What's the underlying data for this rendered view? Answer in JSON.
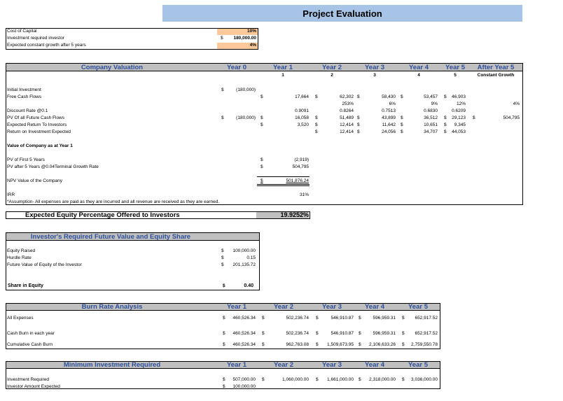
{
  "title": "Project Evaluation",
  "inputs": {
    "rows": [
      {
        "label": "Cost of Capital",
        "cur": "",
        "value": "10%"
      },
      {
        "label": "Investment required investor",
        "cur": "$",
        "value": "180,000.00"
      },
      {
        "label": "Expected constant growth after 5 years",
        "cur": "",
        "value": "4%"
      }
    ]
  },
  "valuation": {
    "title": "Company Valuation",
    "headers": [
      "Year 0",
      "Year 1",
      "Year 2",
      "Year 3",
      "Year 4",
      "Year 5",
      "After Year 5"
    ],
    "numbers": [
      "",
      "1",
      "2",
      "3",
      "4",
      "5",
      "Constant Growth"
    ],
    "rows": [
      {
        "label": "Initial Investment",
        "cells": [
          [
            "$",
            "(180,000)"
          ],
          [
            "",
            ""
          ],
          [
            "",
            ""
          ],
          [
            "",
            ""
          ],
          [
            "",
            ""
          ],
          [
            "",
            ""
          ],
          [
            "",
            ""
          ]
        ]
      },
      {
        "label": "Free Cash Flows",
        "cells": [
          [
            "",
            ""
          ],
          [
            "$",
            "17,664"
          ],
          [
            "$",
            "62,302"
          ],
          [
            "$",
            "58,430"
          ],
          [
            "$",
            "53,457"
          ],
          [
            "$",
            "46,903"
          ],
          [
            "",
            ""
          ]
        ]
      },
      {
        "label": "",
        "cells": [
          [
            "",
            ""
          ],
          [
            "",
            ""
          ],
          [
            "",
            "253%"
          ],
          [
            "",
            "6%"
          ],
          [
            "",
            "9%"
          ],
          [
            "",
            "12%"
          ],
          [
            "",
            "4%"
          ]
        ]
      },
      {
        "label": "Discount Rate @0.1",
        "cells": [
          [
            "",
            ""
          ],
          [
            "",
            "0.9091"
          ],
          [
            "",
            "0.8264"
          ],
          [
            "",
            "0.7513"
          ],
          [
            "",
            "0.6830"
          ],
          [
            "",
            "0.6209"
          ],
          [
            "",
            ""
          ]
        ]
      },
      {
        "label": "PV Of all Future Cash Flows",
        "cells": [
          [
            "$",
            "(180,000)"
          ],
          [
            "$",
            "16,058"
          ],
          [
            "$",
            "51,489"
          ],
          [
            "$",
            "43,899"
          ],
          [
            "$",
            "36,512"
          ],
          [
            "$",
            "29,123"
          ],
          [
            "$",
            "504,795"
          ]
        ]
      },
      {
        "label": "Expected Return To Investors",
        "cells": [
          [
            "",
            ""
          ],
          [
            "$",
            "3,520"
          ],
          [
            "$",
            "12,414"
          ],
          [
            "$",
            "11,642"
          ],
          [
            "$",
            "10,651"
          ],
          [
            "$",
            "9,345"
          ],
          [
            "",
            ""
          ]
        ]
      },
      {
        "label": "Return on Investment Expected",
        "cells": [
          [
            "",
            ""
          ],
          [
            "",
            ""
          ],
          [
            "$",
            "12,414"
          ],
          [
            "$",
            "24,056"
          ],
          [
            "$",
            "34,707"
          ],
          [
            "$",
            "44,053"
          ],
          [
            "",
            ""
          ]
        ]
      }
    ],
    "value_heading": "Value of Company as at Year 1",
    "pv_first_label": "PV of First 5 Years",
    "pv_first_value": "(2,919)",
    "pv_after_label": "PV after 5 Years @0.04Terminal Growth Rate",
    "pv_after_value": "504,795",
    "npv_label": "NPV Value of the Company",
    "npv_value": "501,876.24",
    "irr_label": "IRR",
    "irr_value": "31%",
    "currency": "$",
    "assumption": "*Assumption- All expenses are paid as they are incurred and all revenue are received as they are earned."
  },
  "equity": {
    "label": "Expected Equity Percentage Offered to Investors",
    "value": "19.9252%"
  },
  "investor": {
    "title": "Investor's Required Future Value and Equity Share",
    "rows": [
      {
        "label": "Equity Raised",
        "cur": "$",
        "value": "100,000.00"
      },
      {
        "label": "Hurdle Rate",
        "cur": "$",
        "value": "0.15"
      },
      {
        "label": "Future Value of Equity of the Investor",
        "cur": "$",
        "value": "201,135.72"
      }
    ],
    "share_label": "Share in Equity",
    "share_cur": "$",
    "share_value": "0.40"
  },
  "burn": {
    "title": "Burn Rate Analysis",
    "headers": [
      "Year 1",
      "Year 2",
      "Year 3",
      "Year 4",
      "Year 5"
    ],
    "rows": [
      {
        "label": "All Expenses",
        "values": [
          "460,526.34",
          "502,236.74",
          "546,910.87",
          "596,959.31",
          "652,917.52"
        ]
      },
      {
        "label": "Cash Burn in each year",
        "values": [
          "460,526.34",
          "502,236.74",
          "546,910.87",
          "596,959.31",
          "652,917.52"
        ]
      },
      {
        "label": "Cumulative Cash Burn",
        "values": [
          "460,526.34",
          "962,763.08",
          "1,509,673.95",
          "2,106,633.26",
          "2,759,550.78"
        ]
      }
    ]
  },
  "mininv": {
    "title": "Minimum Investment Required",
    "headers": [
      "Year 1",
      "Year 2",
      "Year 3",
      "Year 4",
      "Year 5"
    ],
    "rows": [
      {
        "label": "Investment Required",
        "values": [
          "507,000.00",
          "1,060,000.00",
          "1,661,000.00",
          "2,318,000.00",
          "3,036,000.00"
        ]
      },
      {
        "label": "Investor Amount Expected",
        "values": [
          "100,000.00",
          "",
          "",
          "",
          ""
        ]
      }
    ]
  }
}
